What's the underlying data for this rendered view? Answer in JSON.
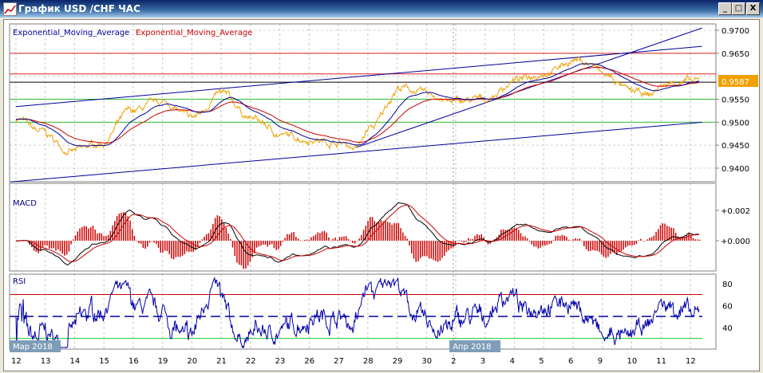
{
  "window": {
    "title": "График USD /CHF  ЧАС",
    "minimize_label": "_",
    "maximize_label": "□",
    "close_label": "X"
  },
  "legend": {
    "ema_fast": "Exponential_Moving_Average",
    "ema_slow": "Exponential_Moving_Average"
  },
  "colors": {
    "price": "#f0a000",
    "ema_fast": "#000099",
    "ema_slow": "#cc0000",
    "support": "#33bb33",
    "resistance": "#dd2222",
    "trend": "#000099",
    "price_tag": "#f0a000"
  },
  "chart_data": [
    {
      "type": "line",
      "title": "USD/CHF H1",
      "ylim": [
        0.937,
        0.9713
      ],
      "yticks": [
        "0.9700",
        "0.9650",
        "0.9550",
        "0.9500",
        "0.9450",
        "0.9400"
      ],
      "current_price": "0.9587",
      "x_labels": [
        "12",
        "13",
        "14",
        "15",
        "16",
        "19",
        "20",
        "21",
        "22",
        "23",
        "26",
        "27",
        "28",
        "29",
        "30",
        "2",
        "3",
        "4",
        "5",
        "6",
        "9",
        "10",
        "11",
        "12"
      ],
      "month_labels": [
        {
          "label": "Мар 2018",
          "day": 0
        },
        {
          "label": "Апр 2018",
          "day": 15
        }
      ],
      "price_keypoints": [
        [
          0,
          0.9509
        ],
        [
          0.8,
          0.948
        ],
        [
          1.9,
          0.9436
        ],
        [
          2.9,
          0.9454
        ],
        [
          3.9,
          0.9523
        ],
        [
          5,
          0.9544
        ],
        [
          6,
          0.9509
        ],
        [
          7,
          0.9561
        ],
        [
          8.1,
          0.9506
        ],
        [
          9.1,
          0.9471
        ],
        [
          10.1,
          0.9462
        ],
        [
          11.1,
          0.9454
        ],
        [
          11.6,
          0.9445
        ],
        [
          12.1,
          0.9488
        ],
        [
          13.1,
          0.9575
        ],
        [
          14.1,
          0.9561
        ],
        [
          14.8,
          0.9544
        ],
        [
          16,
          0.955
        ],
        [
          17.1,
          0.9592
        ],
        [
          18.1,
          0.961
        ],
        [
          19.1,
          0.9636
        ],
        [
          19.6,
          0.9627
        ],
        [
          20.1,
          0.9601
        ],
        [
          21,
          0.9566
        ],
        [
          21.6,
          0.9558
        ],
        [
          22,
          0.9579
        ],
        [
          22.6,
          0.9589
        ],
        [
          23.3,
          0.9587
        ]
      ],
      "horizontal_levels": [
        {
          "price": 0.965,
          "kind": "resistance"
        },
        {
          "price": 0.9605,
          "kind": "resistance"
        },
        {
          "price": 0.9587,
          "kind": "current"
        },
        {
          "price": 0.955,
          "kind": "support"
        },
        {
          "price": 0.95,
          "kind": "support"
        }
      ],
      "trend_lines": [
        [
          [
            0,
            0.9534
          ],
          [
            23.4,
            0.9665
          ]
        ],
        [
          [
            -0.2,
            0.937
          ],
          [
            23.4,
            0.95
          ]
        ],
        [
          [
            11.6,
            0.9445
          ],
          [
            23.4,
            0.9705
          ]
        ]
      ],
      "indicators": [
        "Exponential_Moving_Average",
        "Exponential_Moving_Average"
      ]
    },
    {
      "type": "bar",
      "title": "MACD",
      "yticks": [
        "+0.002",
        "+0.000"
      ],
      "ylim": [
        -0.0019,
        0.0038
      ]
    },
    {
      "type": "line",
      "title": "RSI",
      "yticks": [
        "80",
        "60",
        "40"
      ],
      "levels": [
        70,
        50,
        30
      ],
      "ylim": [
        25,
        88
      ]
    }
  ]
}
